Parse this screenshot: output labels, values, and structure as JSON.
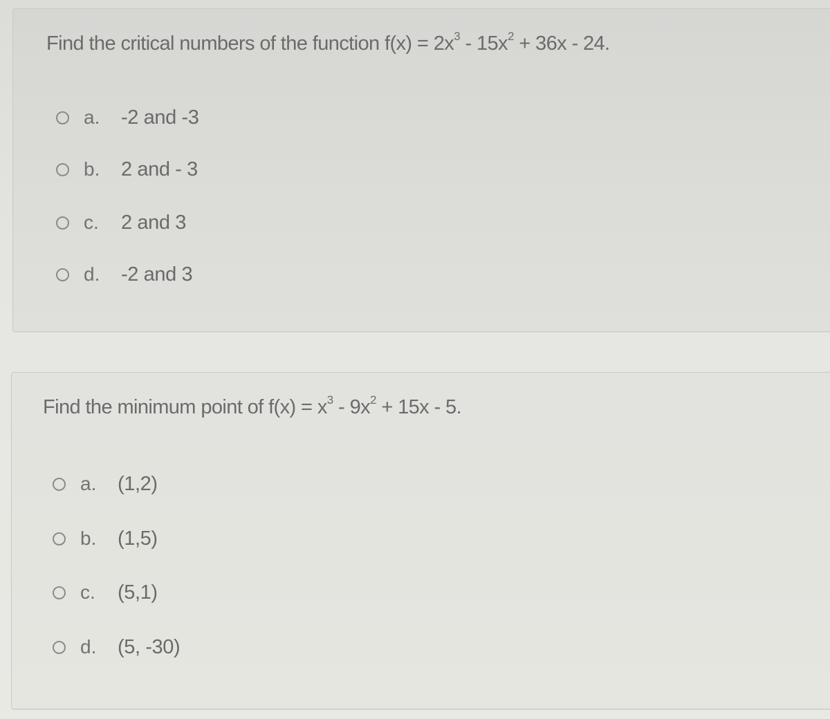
{
  "questions": [
    {
      "prompt_prefix": "Find the critical numbers of the function f(x) = 2x",
      "prompt_parts": [
        "Find the critical numbers of the function f(x) = 2x",
        "3",
        " - 15x",
        "2",
        " + 36x - 24."
      ],
      "options": [
        {
          "letter": "a.",
          "text": "-2 and -3",
          "selected": false
        },
        {
          "letter": "b.",
          "text": "2 and - 3",
          "selected": false
        },
        {
          "letter": "c.",
          "text": "2 and 3",
          "selected": false
        },
        {
          "letter": "d.",
          "text": "-2 and 3",
          "selected": false
        }
      ]
    },
    {
      "prompt_parts": [
        "Find the minimum point of f(x) = x",
        "3",
        " - 9x",
        "2",
        " + 15x - 5."
      ],
      "options": [
        {
          "letter": "a.",
          "text": "(1,2)",
          "selected": false
        },
        {
          "letter": "b.",
          "text": "(1,5)",
          "selected": false
        },
        {
          "letter": "c.",
          "text": "(5,1)",
          "selected": false
        },
        {
          "letter": "d.",
          "text": "(5, -30)",
          "selected": false
        }
      ]
    }
  ]
}
